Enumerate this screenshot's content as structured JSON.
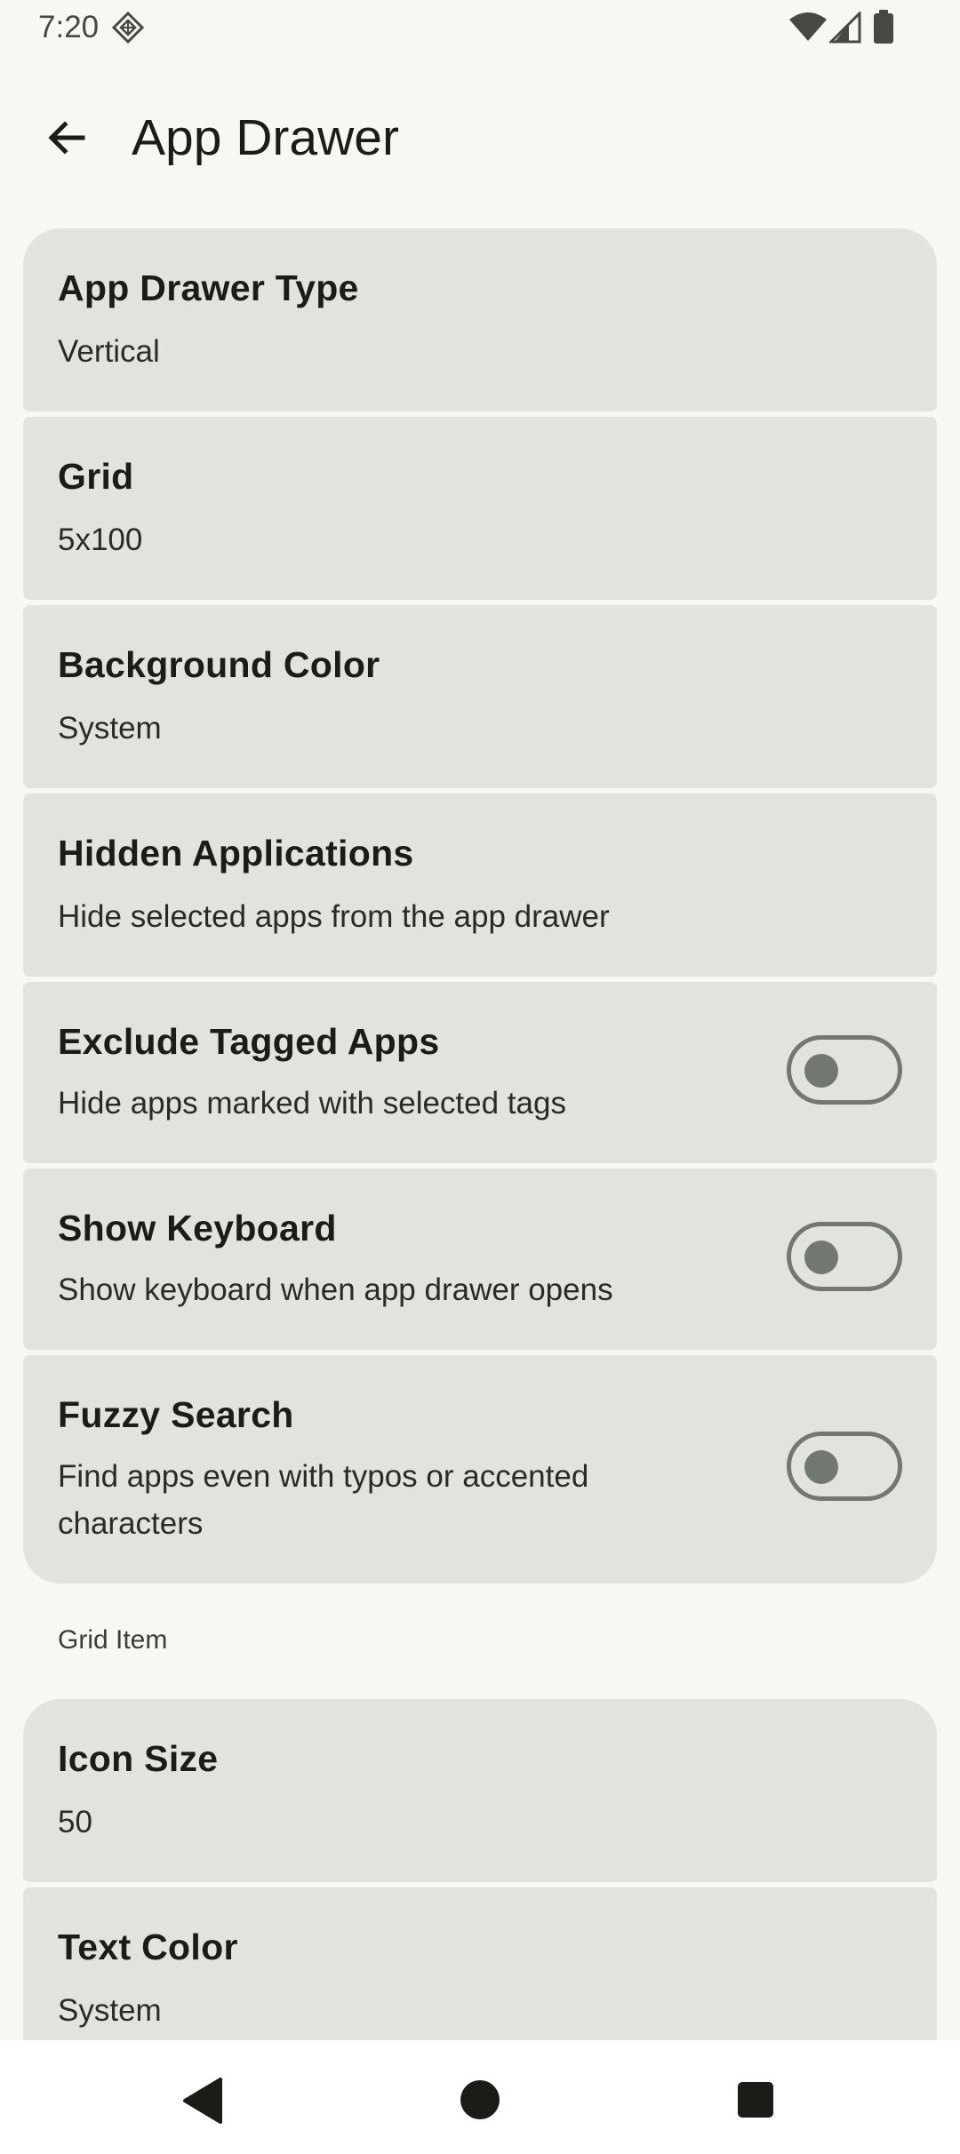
{
  "status_bar": {
    "time": "7:20",
    "icons": [
      "diamond-notification-icon",
      "wifi-icon",
      "signal-icon",
      "battery-icon"
    ]
  },
  "top_bar": {
    "title": "App Drawer",
    "back_icon": "arrow-back-icon"
  },
  "settings": [
    {
      "title": "App Drawer Type",
      "subtitle": "Vertical"
    },
    {
      "title": "Grid",
      "subtitle": "5x100"
    },
    {
      "title": "Background Color",
      "subtitle": "System"
    },
    {
      "title": "Hidden Applications",
      "subtitle": "Hide selected apps from the app drawer"
    },
    {
      "title": "Exclude Tagged Apps",
      "subtitle": "Hide apps marked with selected tags",
      "toggle": false
    },
    {
      "title": "Show Keyboard",
      "subtitle": "Show keyboard when app drawer opens",
      "toggle": false
    },
    {
      "title": "Fuzzy Search",
      "subtitle": "Find apps even with typos or accented characters",
      "toggle": false
    }
  ],
  "section_grid_item": {
    "header": "Grid Item",
    "items": [
      {
        "title": "Icon Size",
        "subtitle": "50"
      },
      {
        "title": "Text Color",
        "subtitle": "System"
      }
    ]
  },
  "nav_bar": {
    "icons": [
      "nav-back-icon",
      "nav-home-icon",
      "nav-recents-icon"
    ]
  },
  "colors": {
    "background": "#f7f8f2",
    "card": "#e1e3dc",
    "toggle_outline": "#72776f",
    "text_primary": "#1b1c18"
  }
}
